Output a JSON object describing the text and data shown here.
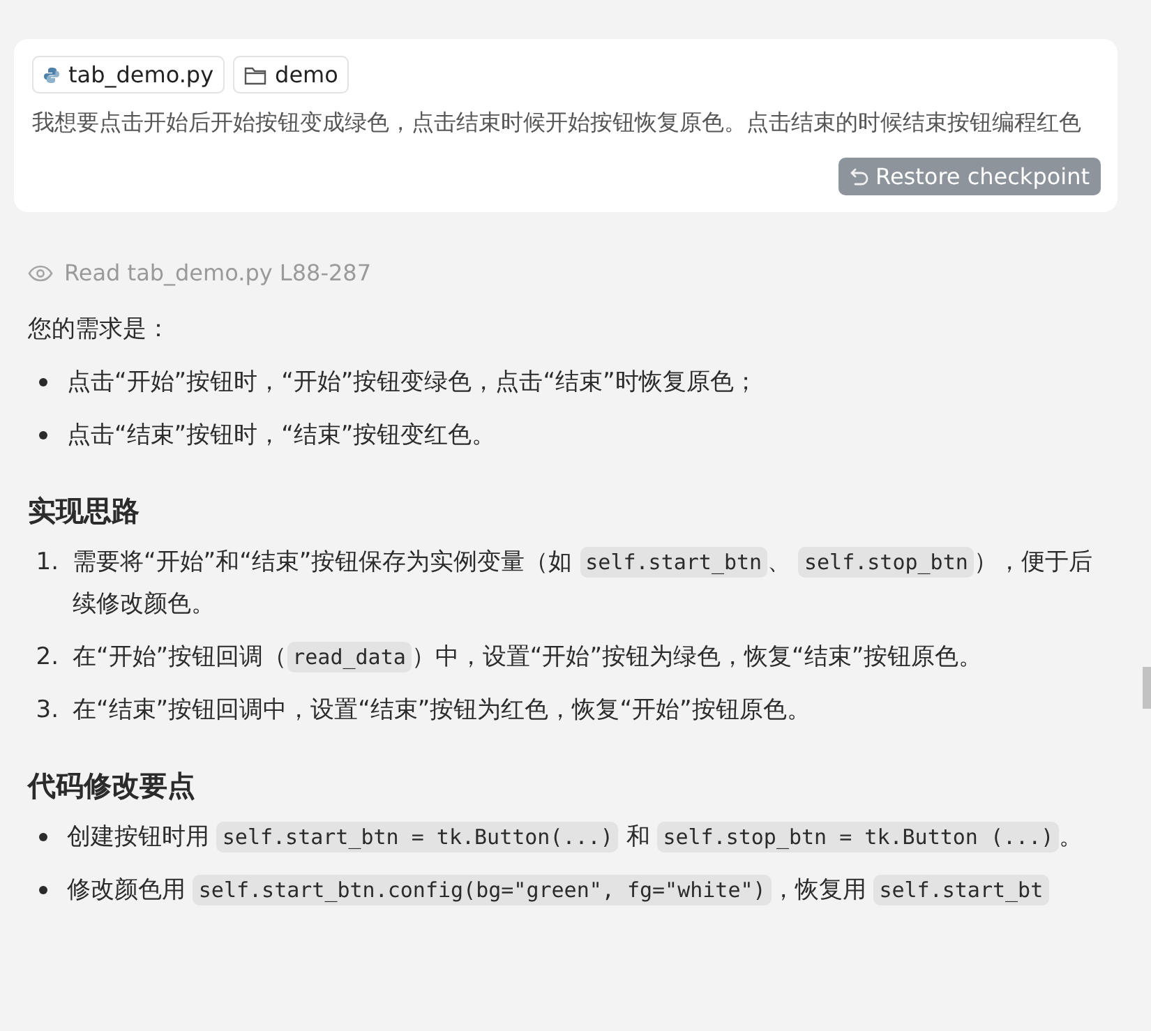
{
  "prompt_card": {
    "chips": [
      {
        "kind": "file",
        "label": "tab_demo.py"
      },
      {
        "kind": "folder",
        "label": "demo"
      }
    ],
    "message": "我想要点击开始后开始按钮变成绿色，点击结束时候开始按钮恢复原色。点击结束的时候结束按钮编程红色",
    "restore_button": "Restore checkpoint"
  },
  "read_status": {
    "text": "Read tab_demo.py L88-287"
  },
  "blocks": [
    {
      "kind": "paragraph",
      "parts": [
        {
          "kind": "text",
          "text": "您的需求是："
        }
      ]
    },
    {
      "kind": "bullets",
      "items": [
        {
          "parts": [
            {
              "kind": "text",
              "text": "点击“开始”按钮时，“开始”按钮变绿色，点击“结束”时恢复原色；"
            }
          ]
        },
        {
          "parts": [
            {
              "kind": "text",
              "text": "点击“结束”按钮时，“结束”按钮变红色。"
            }
          ]
        }
      ]
    },
    {
      "kind": "heading",
      "text": "实现思路"
    },
    {
      "kind": "numbered",
      "items": [
        {
          "marker": "1.",
          "parts": [
            {
              "kind": "text",
              "text": "需要将“开始”和“结束”按钮保存为实例变量（如 "
            },
            {
              "kind": "code",
              "text": "self.start_btn"
            },
            {
              "kind": "text",
              "text": "、 "
            },
            {
              "kind": "code",
              "text": "self.stop_btn"
            },
            {
              "kind": "text",
              "text": "），便于后续修改颜色。"
            }
          ]
        },
        {
          "marker": "2.",
          "parts": [
            {
              "kind": "text",
              "text": "在“开始”按钮回调（"
            },
            {
              "kind": "code",
              "text": "read_data"
            },
            {
              "kind": "text",
              "text": "）中，设置“开始”按钮为绿色，恢复“结束”按钮原色。"
            }
          ]
        },
        {
          "marker": "3.",
          "parts": [
            {
              "kind": "text",
              "text": "在“结束”按钮回调中，设置“结束”按钮为红色，恢复“开始”按钮原色。"
            }
          ]
        }
      ]
    },
    {
      "kind": "heading",
      "text": "代码修改要点"
    },
    {
      "kind": "bullets",
      "items": [
        {
          "parts": [
            {
              "kind": "text",
              "text": "创建按钮时用 "
            },
            {
              "kind": "code",
              "text": "self.start_btn = tk.Button(...)"
            },
            {
              "kind": "text",
              "text": " 和 "
            },
            {
              "kind": "code",
              "text": "self.stop_btn = tk.Button (...)"
            },
            {
              "kind": "text",
              "text": "。"
            }
          ]
        },
        {
          "parts": [
            {
              "kind": "text",
              "text": "修改颜色用 "
            },
            {
              "kind": "code",
              "text": "self.start_btn.config(bg=\"green\", fg=\"white\")"
            },
            {
              "kind": "text",
              "text": "，恢复用 "
            },
            {
              "kind": "code",
              "text": "self.start_bt"
            }
          ]
        }
      ]
    }
  ]
}
